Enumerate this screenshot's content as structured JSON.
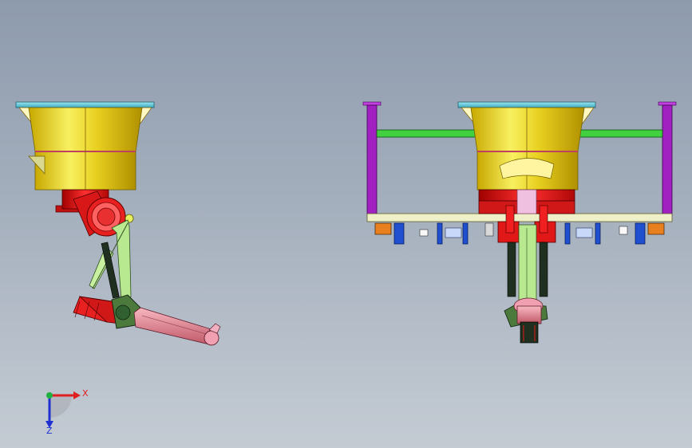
{
  "viewport": {
    "background_top": "#8e9bad",
    "background_bottom": "#c4cbd3"
  },
  "triad": {
    "x_label": "X",
    "z_label": "Z",
    "x_color": "#e02020",
    "y_color": "#20b040",
    "z_color": "#2030d0"
  },
  "colors": {
    "flange": "#5fc8d8",
    "cylinder": "#e8d020",
    "joint": "#e01818",
    "arm_green": "#b8e890",
    "link_pink": "#e88898",
    "frame_purple": "#a020c0",
    "rail_green": "#40d040",
    "plate_cream": "#f0f0c8",
    "bracket_blue": "#2050d0",
    "bracket_orange": "#e88020"
  },
  "models": {
    "side_view": "robot-side-view",
    "front_view": "robot-front-view"
  }
}
